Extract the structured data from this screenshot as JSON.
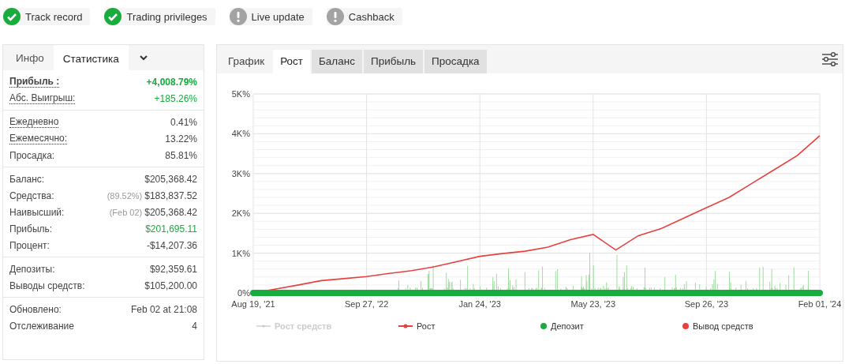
{
  "badges": [
    {
      "label": "Track record",
      "kind": "ok"
    },
    {
      "label": "Trading privileges",
      "kind": "ok"
    },
    {
      "label": "Live update",
      "kind": "warning"
    },
    {
      "label": "Cashback",
      "kind": "warning"
    }
  ],
  "stats_panel": {
    "tabs": [
      {
        "label": "Инфо",
        "selected": false
      },
      {
        "label": "Статистика",
        "selected": true
      }
    ],
    "sections": [
      [
        {
          "label": "Прибыль :",
          "value": "+4,008.79%",
          "underlined": true,
          "bold": true,
          "positive": true
        },
        {
          "label": "Абс. Выигрыш:",
          "value": "+185.26%",
          "underlined": true,
          "bold": false,
          "positive": true
        }
      ],
      [
        {
          "label": "Ежедневно",
          "value": "0.41%",
          "underlined": true,
          "bold": false,
          "positive": false
        },
        {
          "label": "Ежемесячно:",
          "value": "13.22%",
          "underlined": true,
          "bold": false,
          "positive": false
        },
        {
          "label": "Просадка:",
          "value": "85.81%",
          "underlined": false,
          "bold": false,
          "positive": false
        }
      ],
      [
        {
          "label": "Баланс:",
          "value": "$205,368.42",
          "underlined": false,
          "bold": false,
          "positive": false
        },
        {
          "label": "Средства:",
          "note": "(89.52%)",
          "value": "$183,837.52",
          "underlined": false,
          "bold": false,
          "positive": false
        },
        {
          "label": "Наивысший:",
          "note": "(Feb 02)",
          "value": "$205,368.42",
          "underlined": false,
          "bold": false,
          "positive": false
        },
        {
          "label": "Прибыль:",
          "value": "$201,695.11",
          "underlined": false,
          "bold": false,
          "positive": true
        },
        {
          "label": "Процент:",
          "value": "-$14,207.36",
          "underlined": false,
          "bold": false,
          "positive": false
        }
      ],
      [
        {
          "label": "Депозиты:",
          "value": "$92,359.61",
          "underlined": false,
          "bold": false,
          "positive": false
        },
        {
          "label": "Выводы средств:",
          "value": "$105,200.00",
          "underlined": false,
          "bold": false,
          "positive": false
        }
      ],
      [
        {
          "label": "Обновлено:",
          "value": "Feb 02 at 21:08",
          "underlined": false,
          "bold": false,
          "positive": false
        },
        {
          "label": "Отслеживание",
          "value": "4",
          "underlined": false,
          "bold": false,
          "positive": false
        }
      ]
    ]
  },
  "chart_panel": {
    "tabs": [
      {
        "label": "График",
        "kind": "plain",
        "selected": false
      },
      {
        "label": "Рост",
        "kind": "tab",
        "selected": true
      },
      {
        "label": "Баланс",
        "kind": "tab",
        "selected": false
      },
      {
        "label": "Прибыль",
        "kind": "tab",
        "selected": false
      },
      {
        "label": "Просадка",
        "kind": "tab",
        "selected": false
      }
    ],
    "chart_data": {
      "type": "line",
      "categories": [
        "Aug 19, '21",
        null,
        null,
        null,
        null,
        "Sep 27, '22",
        null,
        null,
        null,
        null,
        "Jan 24, '23",
        null,
        null,
        null,
        null,
        "May 23, '23",
        null,
        null,
        null,
        null,
        "Sep 26, '23",
        null,
        null,
        null,
        null,
        "Feb 01, '24"
      ],
      "series": [
        {
          "name": "Рост",
          "color": "#e8413c",
          "values": [
            0,
            100,
            200,
            310,
            360,
            410,
            490,
            560,
            660,
            790,
            920,
            990,
            1050,
            1150,
            1340,
            1470,
            1080,
            1440,
            1620,
            1880,
            2140,
            2400,
            2750,
            3100,
            3450,
            3950
          ]
        }
      ],
      "ylim": [
        0,
        5000
      ],
      "grid": true,
      "yticks": [
        {
          "value": 0,
          "label": "0%"
        },
        {
          "value": 1000,
          "label": "1K%"
        },
        {
          "value": 2000,
          "label": "2K%"
        },
        {
          "value": 3000,
          "label": "3K%"
        },
        {
          "value": 4000,
          "label": "4K%"
        },
        {
          "value": 5000,
          "label": "5K%"
        }
      ]
    },
    "legend": [
      {
        "label": "Рост средств",
        "kind": "line",
        "color": "#c8c8c8",
        "hidden": true
      },
      {
        "kind": "series",
        "hidden": false
      },
      {
        "label": "Депозит",
        "kind": "dot",
        "color": "#1aab3f",
        "hidden": false
      },
      {
        "label": "Вывод средств",
        "kind": "dot",
        "color": "#e8413c",
        "hidden": false
      }
    ]
  }
}
